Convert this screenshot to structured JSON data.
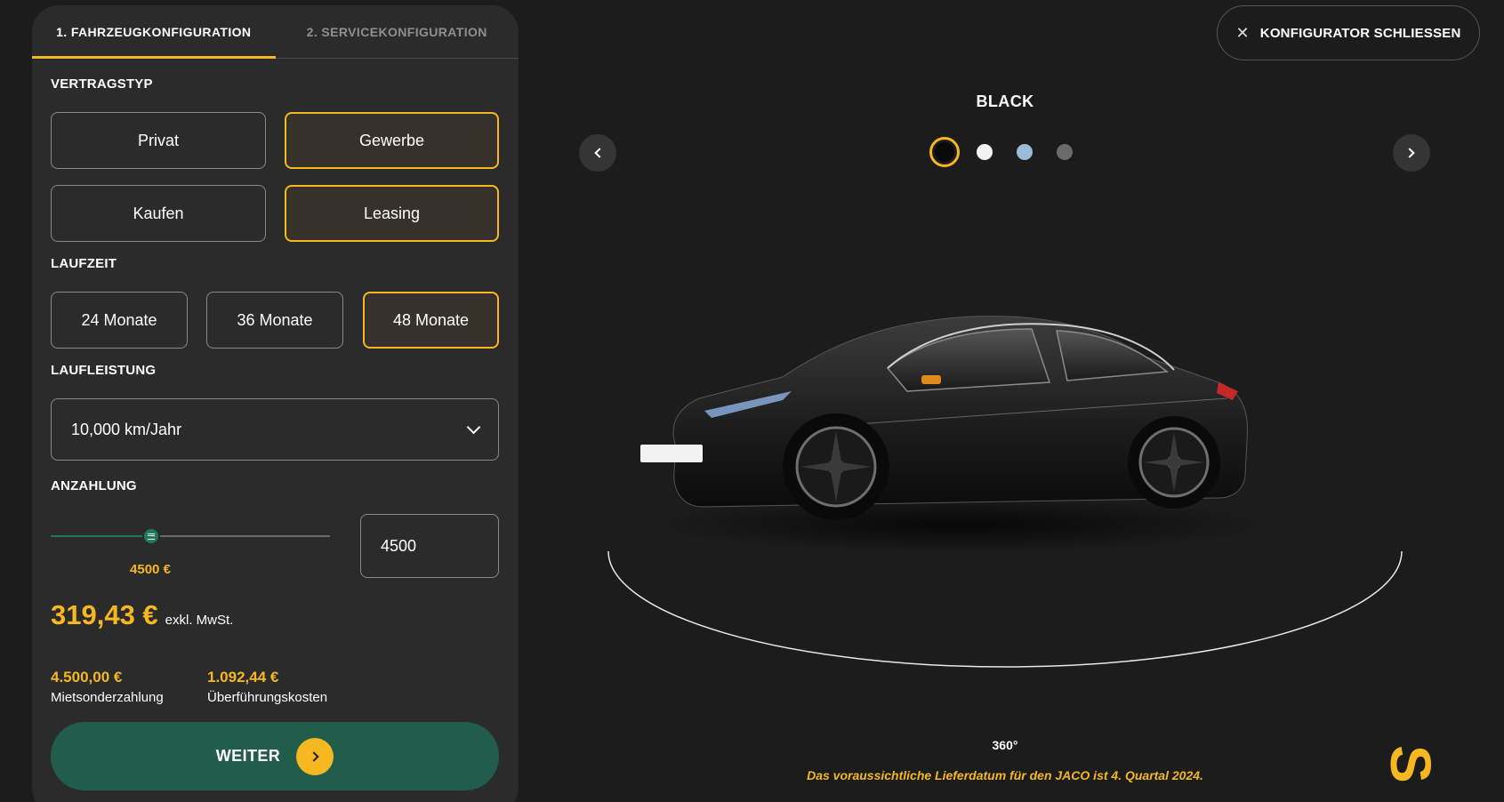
{
  "tabs": [
    {
      "label": "1. FAHRZEUGKONFIGURATION",
      "active": true
    },
    {
      "label": "2. SERVICEKONFIGURATION",
      "active": false
    }
  ],
  "vertragstyp": {
    "label": "VERTRAGSTYP",
    "options_customer": [
      "Privat",
      "Gewerbe"
    ],
    "options_purchase": [
      "Kaufen",
      "Leasing"
    ],
    "selected_customer": "Gewerbe",
    "selected_purchase": "Leasing"
  },
  "laufzeit": {
    "label": "LAUFZEIT",
    "options": [
      "24 Monate",
      "36 Monate",
      "48 Monate"
    ],
    "selected": "48 Monate"
  },
  "laufleistung": {
    "label": "LAUFLEISTUNG",
    "value": "10,000 km/Jahr"
  },
  "anzahlung": {
    "label": "ANZAHLUNG",
    "slider_value_label": "4500 €",
    "slider_fraction": 0.36,
    "input_value": "4500"
  },
  "price": {
    "value": "319,43 €",
    "note": "exkl. MwSt."
  },
  "costs": [
    {
      "value": "4.500,00 €",
      "label": "Mietsonderzahlung"
    },
    {
      "value": "1.092,44 €",
      "label": "Überführungskosten"
    }
  ],
  "next_button": {
    "label": "WEITER"
  },
  "close_button": {
    "label": "KONFIGURATOR SCHLIESSEN"
  },
  "viewer": {
    "color_name": "BLACK",
    "swatches": [
      {
        "color": "#0a0a0a",
        "selected": true
      },
      {
        "color": "#f2f2f2",
        "selected": false
      },
      {
        "color": "#9bbbd8",
        "selected": false
      },
      {
        "color": "#6b6b6b",
        "selected": false
      }
    ],
    "rotation_label": "360°",
    "delivery_note": "Das voraussichtliche Lieferdatum für den JACO ist 4. Quartal 2024."
  },
  "colors": {
    "accent": "#f5b820",
    "primary_button": "#225c4a",
    "slider": "#1f7a5a",
    "panel": "#2b2b2b",
    "background": "#1c1c1c"
  }
}
